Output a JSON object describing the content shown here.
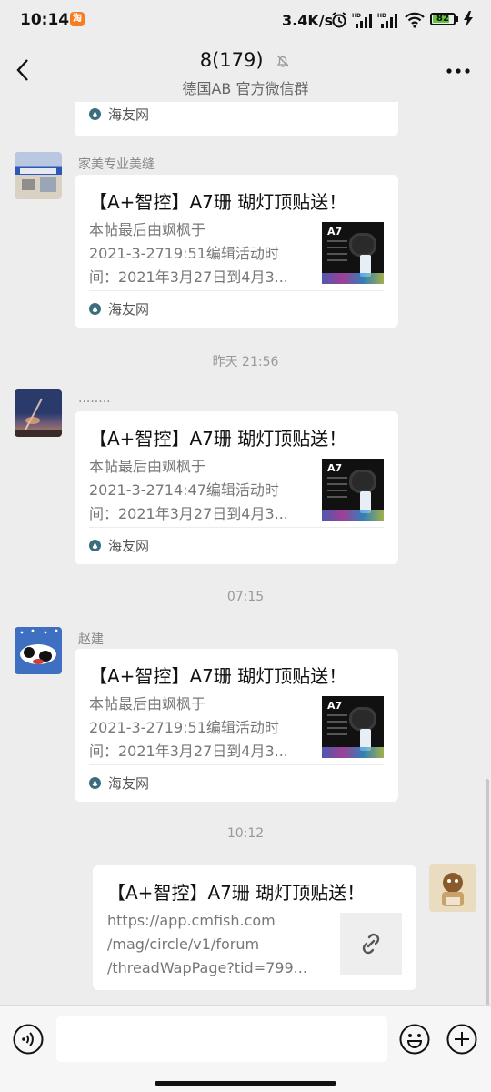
{
  "status": {
    "time": "10:14",
    "app_badge": "淘",
    "net_speed": "3.4K/s",
    "battery": "82",
    "battery_level": 0.82
  },
  "header": {
    "title": "8(179)",
    "subtitle": "德国AB  官方微信群"
  },
  "source_name": "海友网",
  "messages": [
    {
      "sender": "家美专业美缝",
      "title": "【A+智控】A7珊  瑚灯顶贴送！",
      "desc": [
        "本帖最后由飒枫于",
        "2021-3-2719:51编辑活动时",
        "间：2021年3月27日到4月3..."
      ],
      "source": "海友网"
    },
    {
      "time": "昨天 21:56",
      "sender": "........",
      "title": "【A+智控】A7珊  瑚灯顶贴送！",
      "desc": [
        "本帖最后由飒枫于",
        "2021-3-2714:47编辑活动时",
        "间：2021年3月27日到4月3..."
      ],
      "source": "海友网"
    },
    {
      "time": "07:15",
      "sender": "赵建",
      "title": "【A+智控】A7珊  瑚灯顶贴送！",
      "desc": [
        "本帖最后由飒枫于",
        "2021-3-2719:51编辑活动时",
        "间：2021年3月27日到4月3..."
      ],
      "source": "海友网"
    },
    {
      "time": "10:12",
      "title": "【A+智控】A7珊  瑚灯顶贴送！",
      "desc": [
        "https://app.cmfish.com",
        "/mag/circle/v1/forum",
        "/threadWapPage?tid=799..."
      ]
    }
  ],
  "thumb_label": "A7",
  "input": {
    "placeholder": ""
  },
  "colors": {
    "background": "#ededed",
    "card": "#ffffff",
    "battery": "#63c53f",
    "badge": "#f57c1f"
  },
  "icons": [
    "back-arrow-icon",
    "mute-bell-icon",
    "more-icon",
    "link-icon",
    "voice-icon",
    "emoji-icon",
    "plus-icon",
    "wifi-icon",
    "alarm-icon",
    "signal-icon"
  ]
}
